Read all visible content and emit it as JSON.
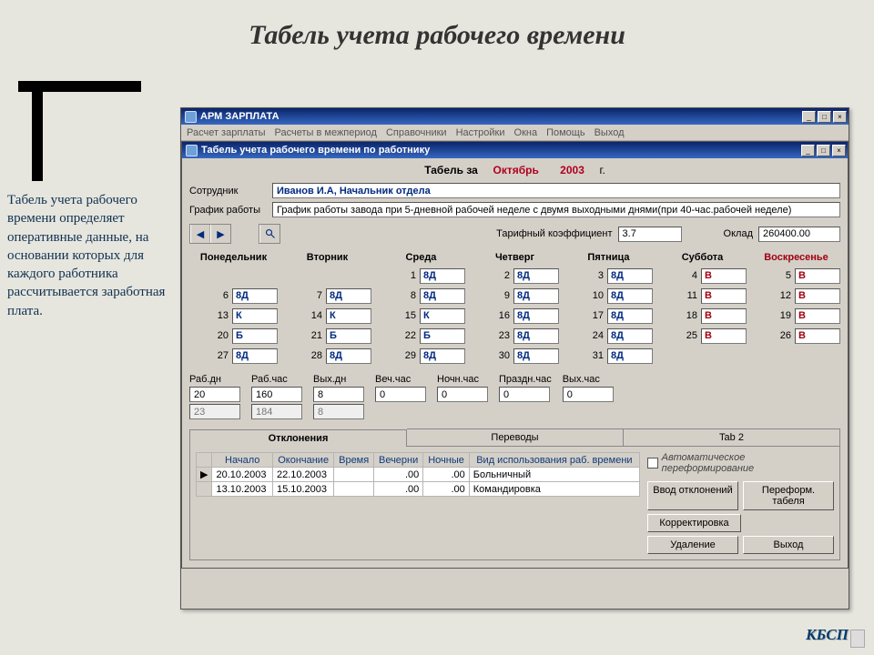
{
  "slide": {
    "title": "Табель учета рабочего времени",
    "sidebar": "Табель учета рабочего времени определяет оперативные данные, на основании которых для каждого работника рассчитывается заработная плата.",
    "brand": "КБСП"
  },
  "app": {
    "title": "АРМ ЗАРПЛАТА",
    "menu": [
      "Расчет зарплаты",
      "Расчеты в межпериод",
      "Справочники",
      "Настройки",
      "Окна",
      "Помощь",
      "Выход"
    ],
    "child_title": "Табель учета рабочего времени по работнику",
    "caption_prefix": "Табель за",
    "caption_month": "Октябрь",
    "caption_year": "2003",
    "caption_suffix": "г.",
    "labels": {
      "employee": "Сотрудник",
      "schedule": "График работы",
      "coef": "Тарифный коэффициент",
      "salary": "Оклад"
    },
    "employee_value": "Иванов И.А,   Начальник отдела",
    "schedule_value": "График работы завода при 5-дневной рабочей неделе с двумя выходными днями(при 40-час.рабочей неделе)",
    "coef_value": "3.7",
    "salary_value": "260400.00",
    "day_headers": [
      "Понедельник",
      "Вторник",
      "Среда",
      "Четверг",
      "Пятница",
      "Суббота",
      "Воскресенье"
    ],
    "cells": [
      [
        "",
        "",
        "1:8Д",
        "2:8Д",
        "3:8Д",
        "4:В:r",
        "5:В:r"
      ],
      [
        "6:8Д",
        "7:8Д",
        "8:8Д",
        "9:8Д",
        "10:8Д",
        "11:В:r",
        "12:В:r"
      ],
      [
        "13:К",
        "14:К",
        "15:К",
        "16:8Д",
        "17:8Д",
        "18:В:r",
        "19:В:r"
      ],
      [
        "20:Б",
        "21:Б",
        "22:Б",
        "23:8Д",
        "24:8Д",
        "25:В:r",
        "26:В:r"
      ],
      [
        "27:8Д",
        "28:8Д",
        "29:8Д",
        "30:8Д",
        "31:8Д",
        "",
        ""
      ]
    ],
    "totals_headers": [
      "Раб.дн",
      "Раб.час",
      "Вых.дн",
      "Веч.час",
      "Ночн.час",
      "Праздн.час",
      "Вых.час"
    ],
    "totals_row1": [
      "20",
      "160",
      "8",
      "0",
      "0",
      "0",
      "0"
    ],
    "totals_row2": [
      "23",
      "184",
      "8",
      "",
      "",
      "",
      ""
    ],
    "tabs": [
      "Отклонения",
      "Переводы",
      "Tab 2"
    ],
    "dev_headers": [
      "Начало",
      "Окончание",
      "Время",
      "Вечерни",
      "Ночные",
      "Вид использования раб. времени"
    ],
    "dev_rows": [
      {
        "ptr": "▶",
        "start": "20.10.2003",
        "end": "22.10.2003",
        "time": "",
        "ev": ".00",
        "night": ".00",
        "kind": "Больничный"
      },
      {
        "ptr": "",
        "start": "13.10.2003",
        "end": "15.10.2003",
        "time": "",
        "ev": ".00",
        "night": ".00",
        "kind": "Командировка"
      }
    ],
    "auto_reform": "Автоматическое переформирование",
    "buttons": {
      "add_dev": "Ввод отклонений",
      "reform": "Переформ. табеля",
      "correct": "Корректировка",
      "delete": "Удаление",
      "exit": "Выход"
    }
  }
}
